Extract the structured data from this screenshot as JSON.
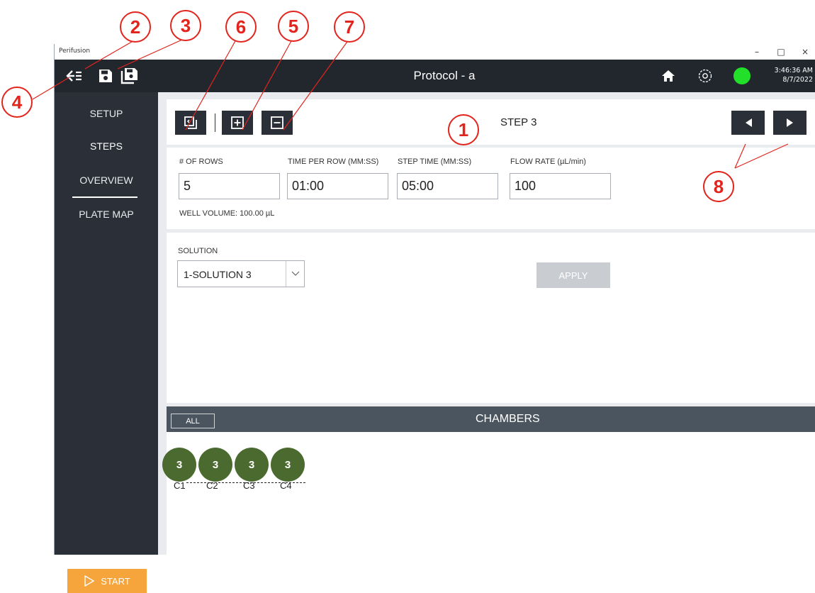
{
  "window": {
    "app_title": "Perifusion",
    "minimize": "–",
    "maximize": "□",
    "close": "×"
  },
  "topbar": {
    "page_title": "Protocol - a",
    "time": "3:46:36 AM",
    "date": "8/7/2022",
    "status_color": "#22e02a"
  },
  "sidebar": {
    "items": [
      {
        "label": "SETUP"
      },
      {
        "label": "STEPS"
      },
      {
        "label": "OVERVIEW"
      },
      {
        "label": "PLATE MAP"
      }
    ],
    "active": "STEPS",
    "start_label": "START"
  },
  "toolbar": {
    "step_label": "STEP 3"
  },
  "fields": {
    "rows": {
      "label": "# OF ROWS",
      "value": "5"
    },
    "time_per_row": {
      "label": "TIME PER ROW (MM:SS)",
      "value": "01:00"
    },
    "step_time": {
      "label": "STEP TIME (MM:SS)",
      "value": "05:00"
    },
    "flow_rate": {
      "label": "FLOW RATE (µL/min)",
      "value": "100"
    },
    "well_volume": "WELL VOLUME: 100.00 µL"
  },
  "solution": {
    "label": "SOLUTION",
    "value": "1-SOLUTION 3",
    "apply_label": "APPLY"
  },
  "chambers": {
    "title": "CHAMBERS",
    "all_label": "ALL",
    "items": [
      {
        "value": "3",
        "name": "C1"
      },
      {
        "value": "3",
        "name": "C2"
      },
      {
        "value": "3",
        "name": "C3"
      },
      {
        "value": "3",
        "name": "C4"
      }
    ]
  },
  "callouts": [
    "1",
    "2",
    "3",
    "4",
    "5",
    "6",
    "7",
    "8"
  ],
  "colors": {
    "topbar": "#22272d",
    "sidebar": "#2b3038",
    "start": "#f6a53c",
    "chamber": "#4a6a2f",
    "callout": "#e2241c"
  }
}
